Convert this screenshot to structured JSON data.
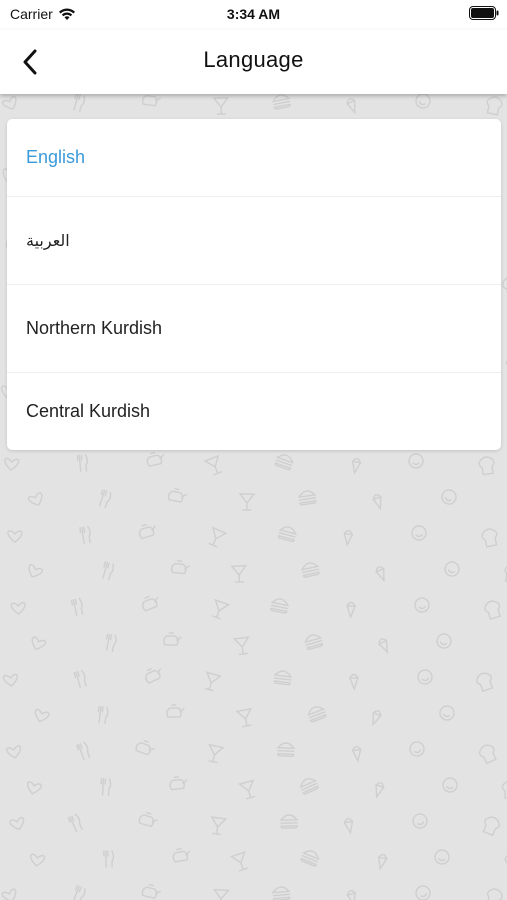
{
  "status_bar": {
    "carrier": "Carrier",
    "time": "3:34 AM"
  },
  "nav": {
    "title": "Language",
    "back_icon": "chevron-left-icon"
  },
  "languages": [
    {
      "label": "English",
      "selected": true
    },
    {
      "label": "العربية",
      "selected": false
    },
    {
      "label": "Northern Kurdish",
      "selected": false
    },
    {
      "label": "Central Kurdish",
      "selected": false
    }
  ],
  "colors": {
    "accent": "#3a9ad9",
    "background": "#e4e4e4",
    "card": "#ffffff"
  }
}
